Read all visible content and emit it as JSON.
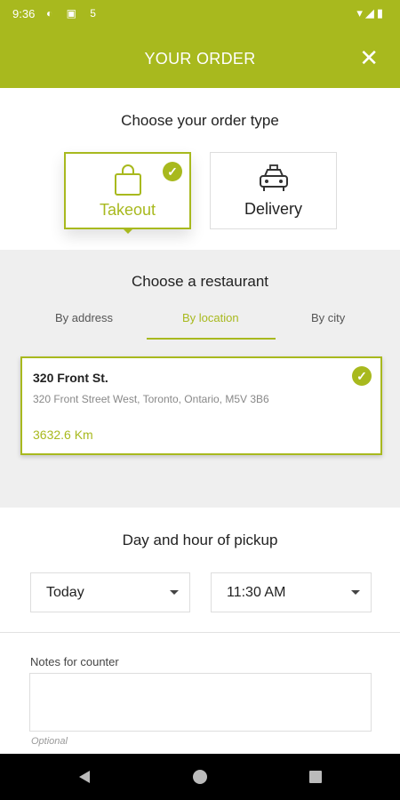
{
  "status_bar": {
    "time": "9:36",
    "icons_left": "◐ ▣ 5",
    "icons_right": "▾◢▮"
  },
  "header": {
    "title": "YOUR ORDER",
    "close_icon": "✕"
  },
  "order_type": {
    "title": "Choose your order type",
    "options": [
      {
        "label": "Takeout",
        "icon": "shopping-bag-icon",
        "selected": true
      },
      {
        "label": "Delivery",
        "icon": "car-icon",
        "selected": false
      }
    ],
    "check_mark": "✓"
  },
  "restaurant": {
    "title": "Choose a restaurant",
    "tabs": [
      {
        "label": "By address",
        "active": false
      },
      {
        "label": "By location",
        "active": true
      },
      {
        "label": "By city",
        "active": false
      }
    ],
    "selected": {
      "name": "320 Front St.",
      "address": "320 Front Street West, Toronto, Ontario, M5V 3B6",
      "distance": "3632.6 Km"
    }
  },
  "pickup": {
    "title": "Day and hour of pickup",
    "day": "Today",
    "hour": "11:30 AM"
  },
  "notes": {
    "label": "Notes for counter",
    "value": "",
    "hint": "Optional"
  },
  "colors": {
    "accent": "#a8b91e",
    "gray_bg": "#efefef"
  }
}
